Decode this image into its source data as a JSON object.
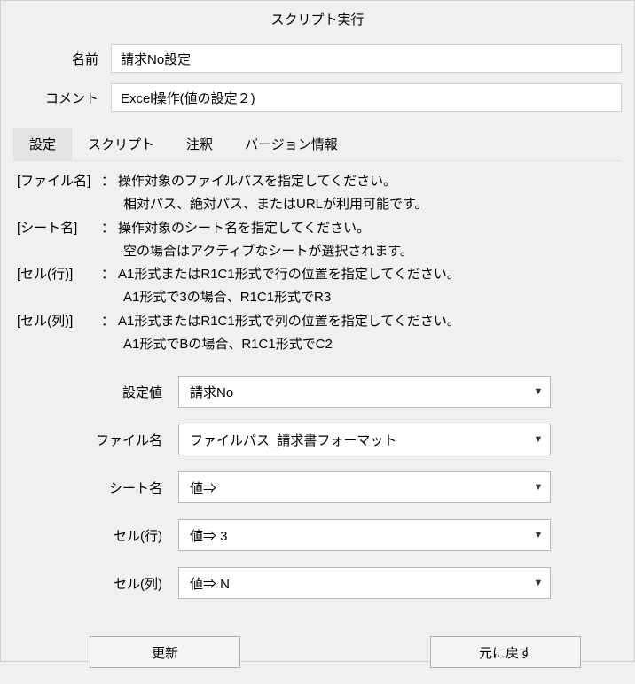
{
  "window": {
    "title": "スクリプト実行"
  },
  "fields": {
    "name_label": "名前",
    "name_value": "請求No設定",
    "comment_label": "コメント",
    "comment_value": "Excel操作(値の設定２)"
  },
  "tabs": {
    "settings": "設定",
    "script": "スクリプト",
    "annotation": "注釈",
    "version": "バージョン情報"
  },
  "help": {
    "file_key": "[ファイル名]",
    "file_text": "操作対象のファイルパスを指定してください。",
    "file_sub": "相対パス、絶対パス、またはURLが利用可能です。",
    "sheet_key": "[シート名]",
    "sheet_text": "操作対象のシート名を指定してください。",
    "sheet_sub": "空の場合はアクティブなシートが選択されます。",
    "row_key": "[セル(行)]",
    "row_text": "A1形式またはR1C1形式で行の位置を指定してください。",
    "row_sub": "A1形式で3の場合、R1C1形式でR3",
    "col_key": "[セル(列)]",
    "col_text": "A1形式またはR1C1形式で列の位置を指定してください。",
    "col_sub": "A1形式でBの場合、R1C1形式でC2"
  },
  "params": {
    "value_label": "設定値",
    "value_selected": "請求No",
    "filename_label": "ファイル名",
    "filename_selected": "ファイルパス_請求書フォーマット",
    "sheetname_label": "シート名",
    "sheetname_selected": "値⇒",
    "cellrow_label": "セル(行)",
    "cellrow_selected": "値⇒  3",
    "cellcol_label": "セル(列)",
    "cellcol_selected": "値⇒  N"
  },
  "buttons": {
    "update": "更新",
    "revert": "元に戻す"
  }
}
